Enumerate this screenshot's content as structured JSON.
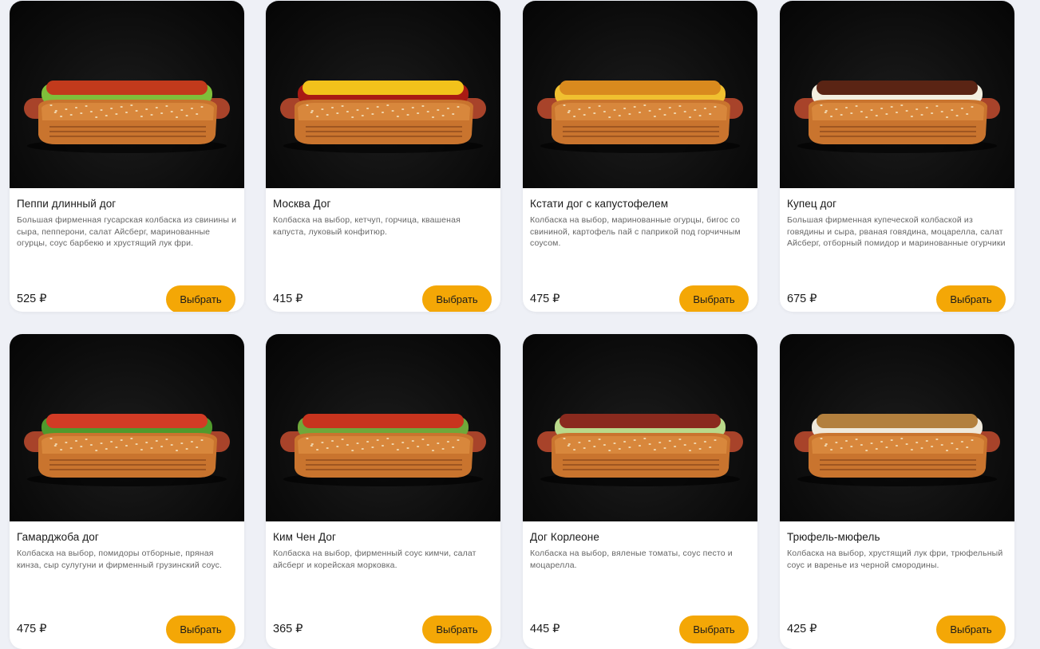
{
  "products": [
    {
      "title": "Пеппи длинный дог",
      "desc": "Большая фирменная гусарская колбаска из свинины и сыра, пепперони, салат Айсберг, маринованные огурцы, соус барбекю и хрустящий лук фри.",
      "price": "525 ₽",
      "button": "Выбрать",
      "topping": "pepperoni"
    },
    {
      "title": "Москва Дог",
      "desc": "Колбаска на выбор, кетчуп, горчица, квашеная капуста, луковый конфитюр.",
      "price": "415 ₽",
      "button": "Выбрать",
      "topping": "cheese-ketchup"
    },
    {
      "title": "Кстати дог с капустофелем",
      "desc": "Колбаска на выбор, маринованные огурцы, бигос со свининой, картофель пай с паприкой под горчичным соусом.",
      "price": "475 ₽",
      "button": "Выбрать",
      "topping": "potato-straw"
    },
    {
      "title": "Купец дог",
      "desc": "Большая фирменная купеческой колбаской из говядины и сыра,  рваная говядина, моцарелла, салат Айсберг, отборный помидор и маринованные огурчики",
      "price": "675 ₽",
      "button": "Выбрать",
      "topping": "pulled-beef"
    },
    {
      "title": "Гамарджоба дог",
      "desc": "Колбаска на выбор, помидоры отборные, пряная кинза, сыр сулугуни и фирменный грузинский соус.",
      "price": "475 ₽",
      "button": "Выбрать",
      "topping": "cilantro"
    },
    {
      "title": "Ким Чен Дог",
      "desc": "Колбаска на выбор, фирменный соус кимчи, салат айсберг  и корейская морковка.",
      "price": "365 ₽",
      "button": "Выбрать",
      "topping": "kimchi"
    },
    {
      "title": "Дог Корлеоне",
      "desc": "Колбаска на выбор, вяленые томаты, соус песто и моцарелла.",
      "price": "445 ₽",
      "button": "Выбрать",
      "topping": "pesto"
    },
    {
      "title": "Трюфель-мюфель",
      "desc": "Колбаска на выбор, хрустящий лук фри, трюфельный соус и варенье из черной смородины.",
      "price": "425 ₽",
      "button": "Выбрать",
      "topping": "fried-onion"
    }
  ],
  "colors": {
    "accent": "#f4a706",
    "background": "#eef0f6"
  }
}
